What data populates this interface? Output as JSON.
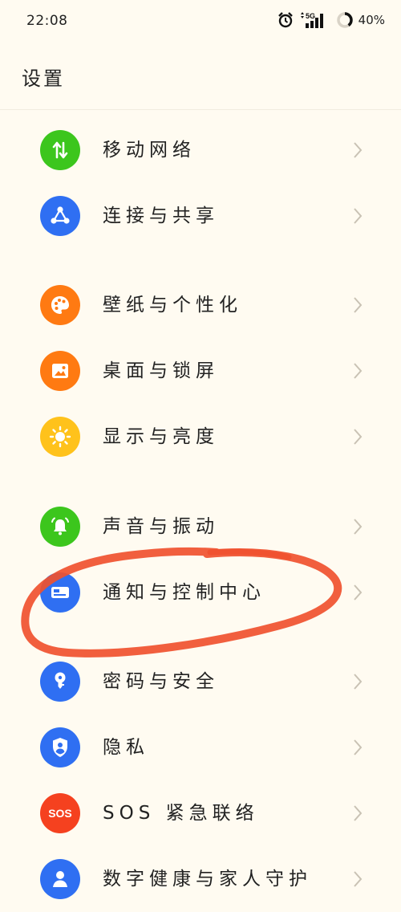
{
  "status_bar": {
    "time": "22:08",
    "network": "5G",
    "battery": "40%"
  },
  "page": {
    "title": "设置"
  },
  "colors": {
    "background": "#fffbf1",
    "green": "#3cc61d",
    "blue": "#2f6ff2",
    "orange": "#ff7a12",
    "yellow": "#ffc21b",
    "red": "#f5411f",
    "annotation": "#f0512f"
  },
  "settings": {
    "items": [
      {
        "label": "移动网络",
        "icon": "data-arrows-icon",
        "color": "#3cc61d"
      },
      {
        "label": "连接与共享",
        "icon": "share-icon",
        "color": "#2f6ff2"
      },
      {
        "label": "壁纸与个性化",
        "icon": "palette-icon",
        "color": "#ff7a12"
      },
      {
        "label": "桌面与锁屏",
        "icon": "picture-icon",
        "color": "#ff7a12"
      },
      {
        "label": "显示与亮度",
        "icon": "sun-icon",
        "color": "#ffc21b"
      },
      {
        "label": "声音与振动",
        "icon": "bell-icon",
        "color": "#3cc61d"
      },
      {
        "label": "通知与控制中心",
        "icon": "notification-card-icon",
        "color": "#2f6ff2"
      },
      {
        "label": "密码与安全",
        "icon": "key-icon",
        "color": "#2f6ff2"
      },
      {
        "label": "隐私",
        "icon": "shield-user-icon",
        "color": "#2f6ff2"
      },
      {
        "label": "SOS 紧急联络",
        "icon": "sos-icon",
        "icon_text": "SOS",
        "color": "#f5411f"
      },
      {
        "label": "数字健康与家人守护",
        "icon": "person-icon",
        "color": "#2f6ff2"
      }
    ]
  }
}
